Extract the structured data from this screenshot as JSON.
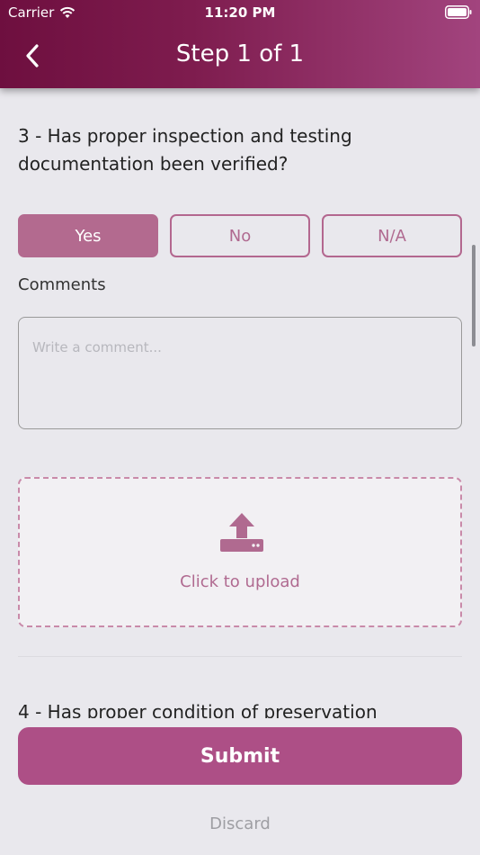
{
  "status_bar": {
    "carrier": "Carrier",
    "time": "11:20 PM"
  },
  "header": {
    "title": "Step 1 of 1",
    "back_icon": "chevron-left-icon",
    "gradient_colors": [
      "#6e0f3f",
      "#a2447e"
    ]
  },
  "question": {
    "text": "3 - Has proper inspection and testing documentation been verified?",
    "answers": [
      {
        "label": "Yes",
        "selected": true
      },
      {
        "label": "No",
        "selected": false
      },
      {
        "label": "N/A",
        "selected": false
      }
    ],
    "comments_label": "Comments",
    "comment_placeholder": "Write a comment...",
    "upload_label": "Click to upload",
    "upload_icon": "upload-icon"
  },
  "next_question": {
    "text": "4 - Has proper condition of preservation"
  },
  "footer": {
    "submit_label": "Submit",
    "discard_label": "Discard"
  },
  "colors": {
    "accent": "#ad4f86",
    "accent_light": "#b36a8f",
    "background": "#e9e8ed"
  }
}
